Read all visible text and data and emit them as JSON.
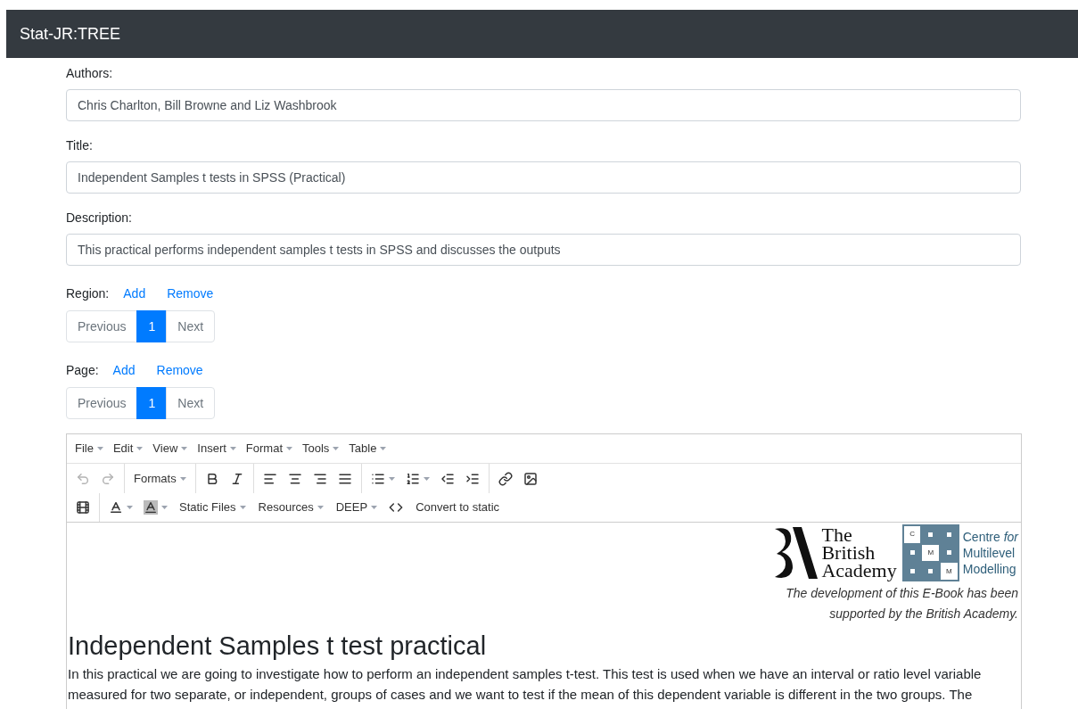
{
  "navbar": {
    "brand": "Stat-JR:TREE"
  },
  "fields": [
    {
      "label": "Authors:",
      "value": "Chris Charlton, Bill Browne and Liz Washbrook"
    },
    {
      "label": "Title:",
      "value": "Independent Samples t tests in SPSS (Practical)"
    },
    {
      "label": "Description:",
      "value": "This practical performs independent samples t tests in SPSS and discusses the outputs"
    }
  ],
  "pagers": [
    {
      "label": "Region:",
      "add": "Add",
      "remove": "Remove",
      "pages": [
        {
          "label": "Previous",
          "selected": false
        },
        {
          "label": "1",
          "selected": true
        },
        {
          "label": "Next",
          "selected": false
        }
      ]
    },
    {
      "label": "Page:",
      "add": "Add",
      "remove": "Remove",
      "pages": [
        {
          "label": "Previous",
          "selected": false
        },
        {
          "label": "1",
          "selected": true
        },
        {
          "label": "Next",
          "selected": false
        }
      ]
    }
  ],
  "editor": {
    "menus": [
      "File",
      "Edit",
      "View",
      "Insert",
      "Format",
      "Tools",
      "Table"
    ],
    "undo": {
      "disabled": true
    },
    "redo": {
      "disabled": true
    },
    "formats": "Formats",
    "row2_menus": [
      "Static Files",
      "Resources",
      "DEEP"
    ],
    "convert": "Convert to static",
    "logo": {
      "ba_lines": [
        "The",
        "British",
        "Academy"
      ],
      "cmm_cells": [
        "C",
        "M",
        "M"
      ],
      "cmm_lines": [
        "Centre *for*",
        "Multilevel",
        "Modelling"
      ]
    },
    "credit_lines": [
      "The development of this E-Book has been",
      "supported by the British Academy."
    ],
    "heading": "Independent Samples t test practical",
    "paragraph": "In this practical we are going to investigate how to perform an independent samples t-test. This test is used when we have an interval or ratio level variable measured for two separate, or independent, groups of cases and we want to test if the mean of this dependent variable is different in the two groups. The"
  }
}
